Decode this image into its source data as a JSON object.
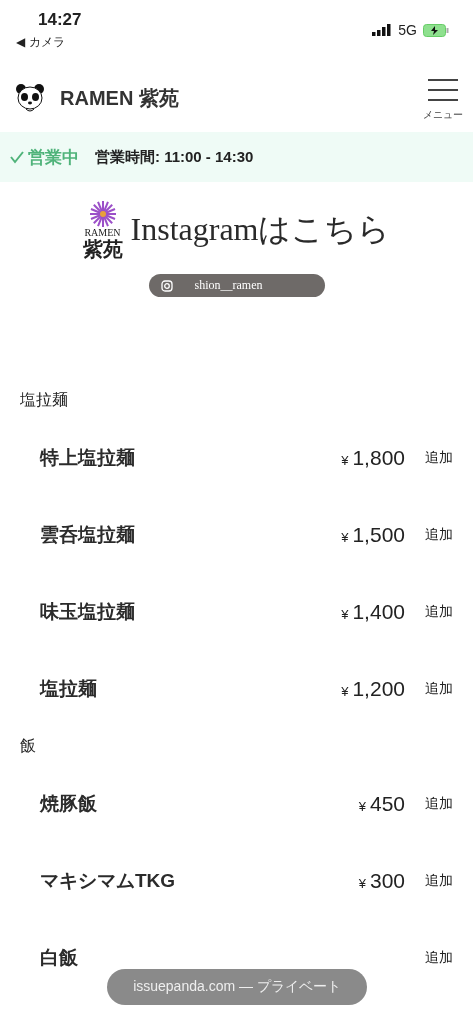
{
  "status_bar": {
    "time": "14:27",
    "back": "◀ カメラ",
    "network": "5G"
  },
  "header": {
    "title": "RAMEN 紫苑",
    "menu_label": "メニュー"
  },
  "open_banner": {
    "status": "営業中",
    "hours": "営業時間: 11:00 - 14:30"
  },
  "instagram_banner": {
    "logo_top": "RAMEN",
    "logo_name": "紫苑",
    "heading": "Instagramはこちら",
    "handle": "shion__ramen"
  },
  "categories": [
    {
      "name": "塩拉麺",
      "items": [
        {
          "name": "特上塩拉麺",
          "currency": "¥",
          "price": "1,800",
          "action": "追加"
        },
        {
          "name": "雲呑塩拉麺",
          "currency": "¥",
          "price": "1,500",
          "action": "追加"
        },
        {
          "name": "味玉塩拉麺",
          "currency": "¥",
          "price": "1,400",
          "action": "追加"
        },
        {
          "name": "塩拉麺",
          "currency": "¥",
          "price": "1,200",
          "action": "追加"
        }
      ]
    },
    {
      "name": "飯",
      "items": [
        {
          "name": "焼豚飯",
          "currency": "¥",
          "price": "450",
          "action": "追加"
        },
        {
          "name": "マキシマムTKG",
          "currency": "¥",
          "price": "300",
          "action": "追加"
        },
        {
          "name": "白飯",
          "action": "追加"
        }
      ]
    }
  ],
  "url_pill": "issuepanda.com — プライベート"
}
